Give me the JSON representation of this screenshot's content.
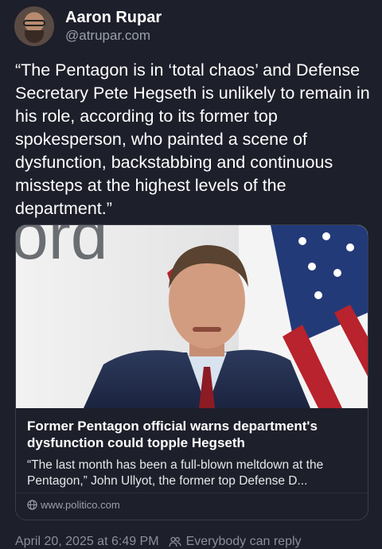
{
  "author": {
    "name": "Aaron Rupar",
    "handle": "@atrupar.com",
    "avatar_icon": "user-avatar"
  },
  "post": {
    "text": "“The Pentagon is in ‘total chaos’ and Defense Secretary Pete Hegseth is unlikely to remain in his role, according to its former top spokesperson, who painted a scene of dysfunction, backstabbing and continuous missteps at the highest levels of the department.”"
  },
  "link_card": {
    "image_text": "ord",
    "title": "Former Pentagon official warns department's dysfunction could topple Hegseth",
    "description": "“The last month has been a full-blown meltdown at the Pentagon,” John Ullyot, the former top Defense D...",
    "domain": "www.politico.com",
    "domain_icon": "globe-icon"
  },
  "footer": {
    "timestamp": "April 20, 2025 at 6:49 PM",
    "visibility_icon": "people-icon",
    "visibility": "Everybody can reply"
  },
  "colors": {
    "background": "#1d1f2a",
    "text": "#ffffff",
    "secondary_text": "#9aa0aa",
    "card_border": "#3a3d4a"
  }
}
